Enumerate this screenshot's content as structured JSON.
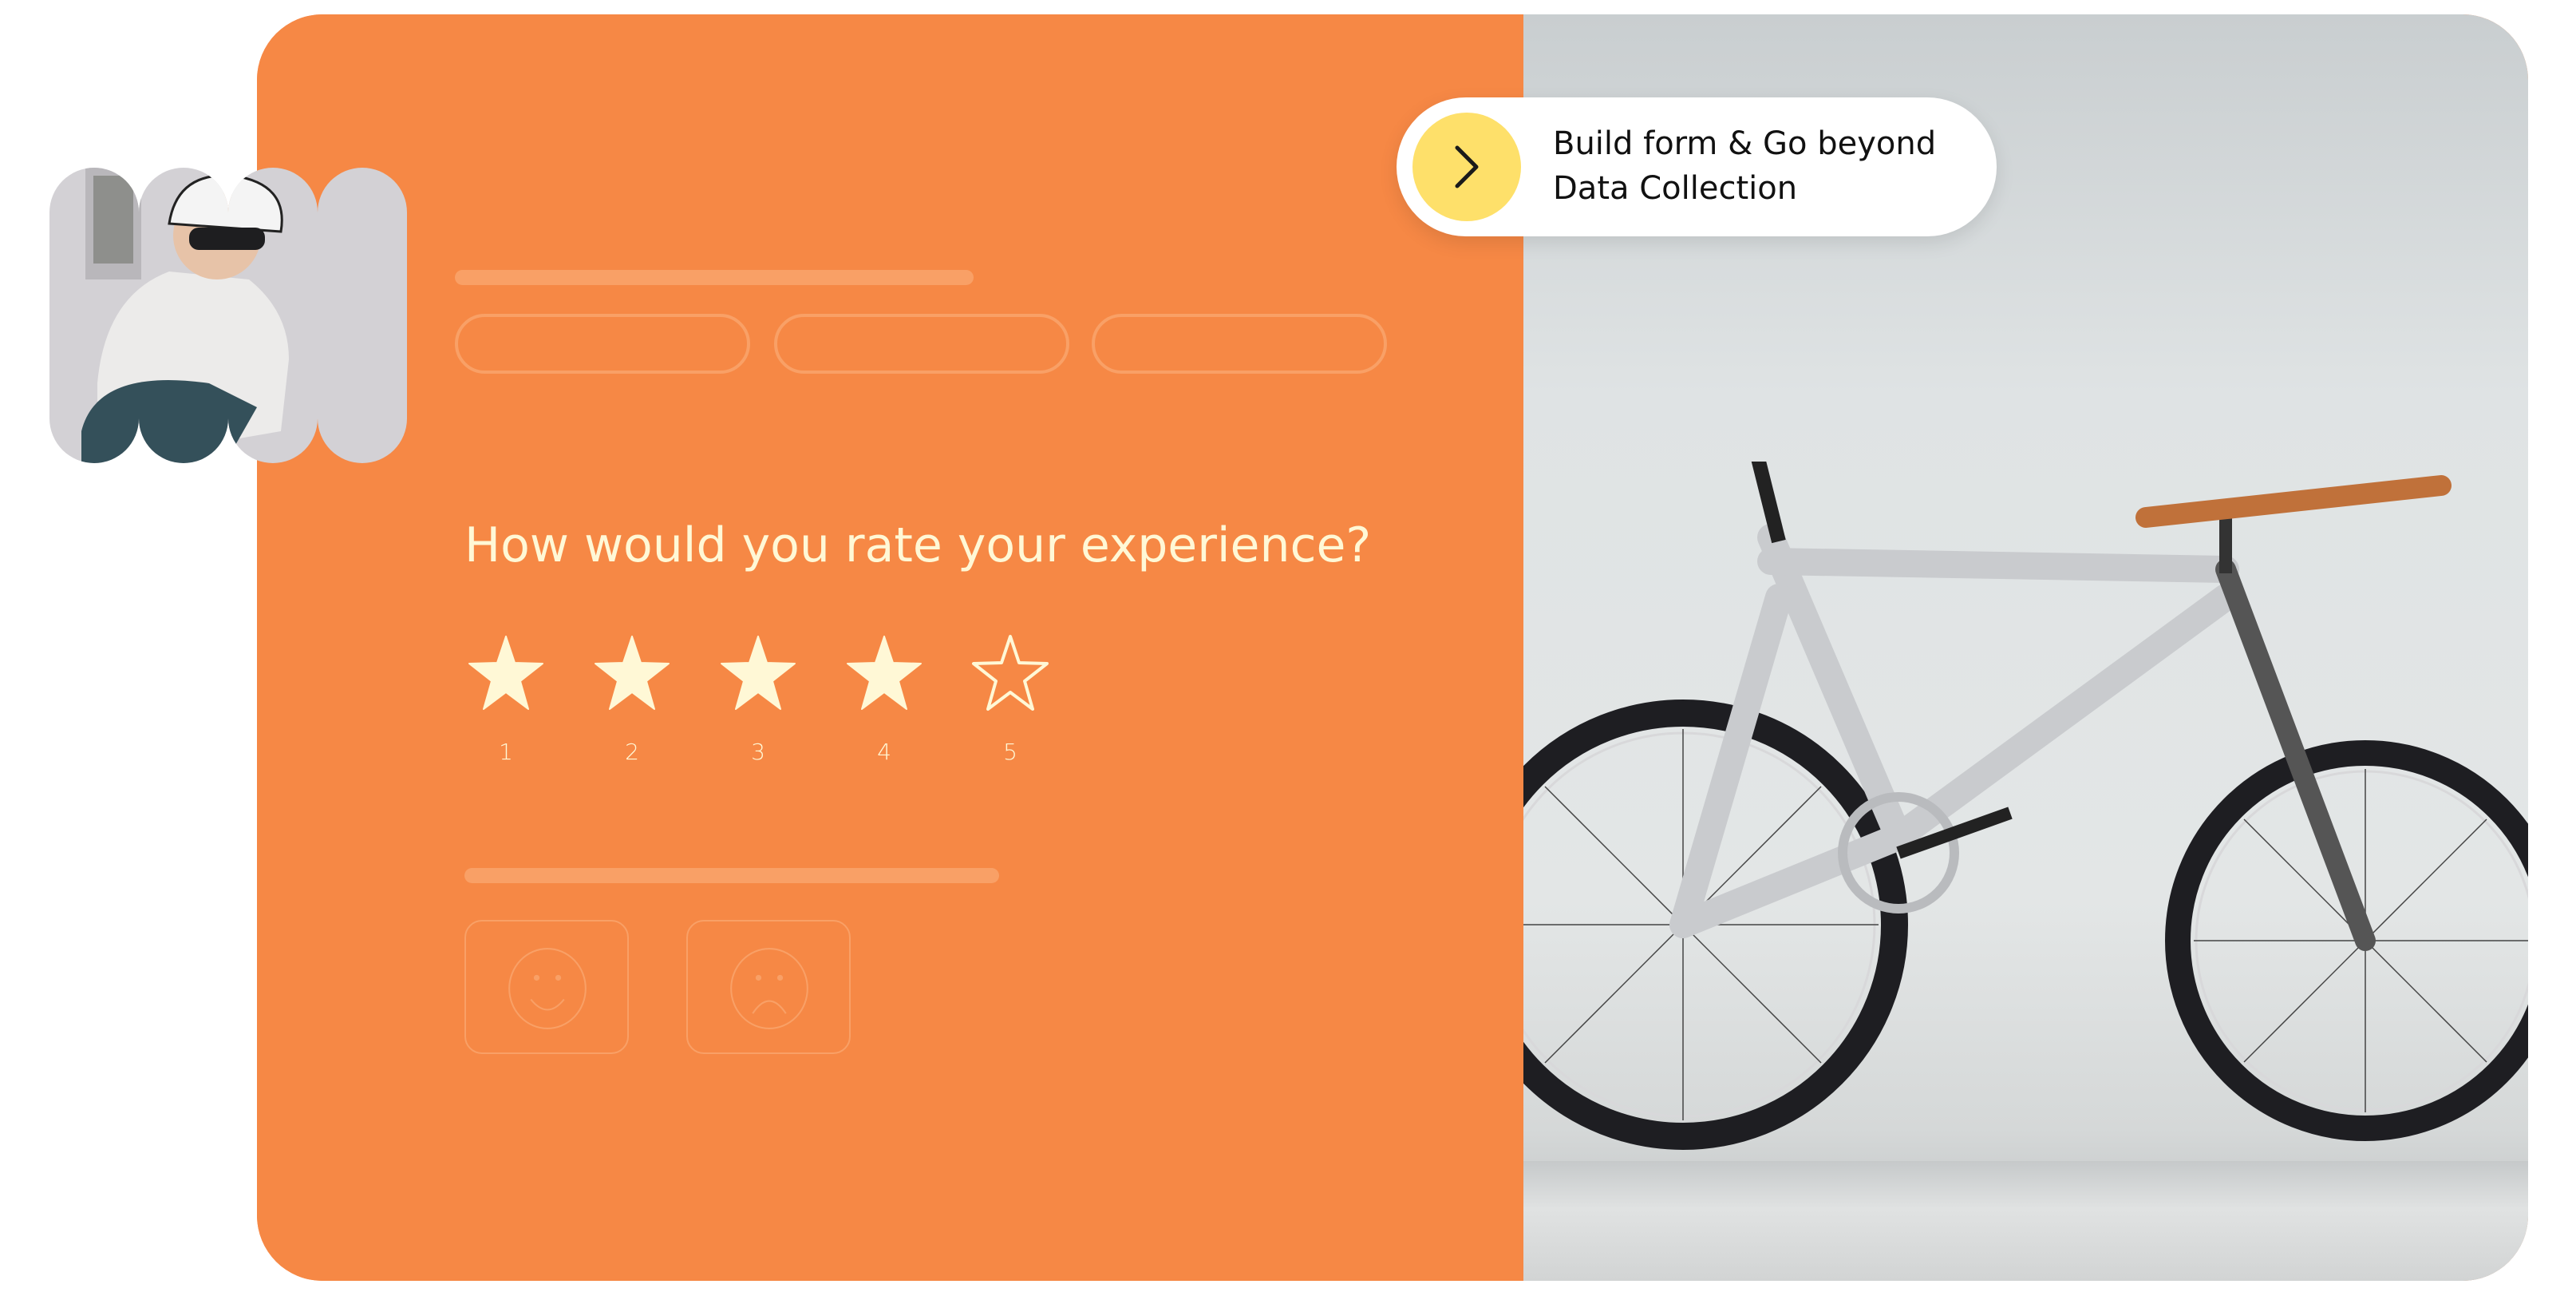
{
  "hero": {
    "cta": {
      "icon": "chevron-right-icon",
      "line1": "Build form & Go beyond",
      "line2": "Data Collection"
    },
    "form_preview": {
      "question": "How would you rate your experience?",
      "rating": {
        "selected": 4,
        "max": 5,
        "labels": [
          "1",
          "2",
          "3",
          "4",
          "5"
        ]
      },
      "choice_pills_count": 3,
      "feedback_faces": [
        "smiley-face-icon",
        "sad-face-icon"
      ]
    },
    "images": {
      "avatar": "cyclist-woman-photo",
      "main": "bicycle-against-wall-photo"
    }
  },
  "colors": {
    "form_bg": "#f68845",
    "placeholder": "#f9a066",
    "text_light": "#fff8d6",
    "cta_circle": "#fee06a",
    "cta_text": "#111111"
  }
}
